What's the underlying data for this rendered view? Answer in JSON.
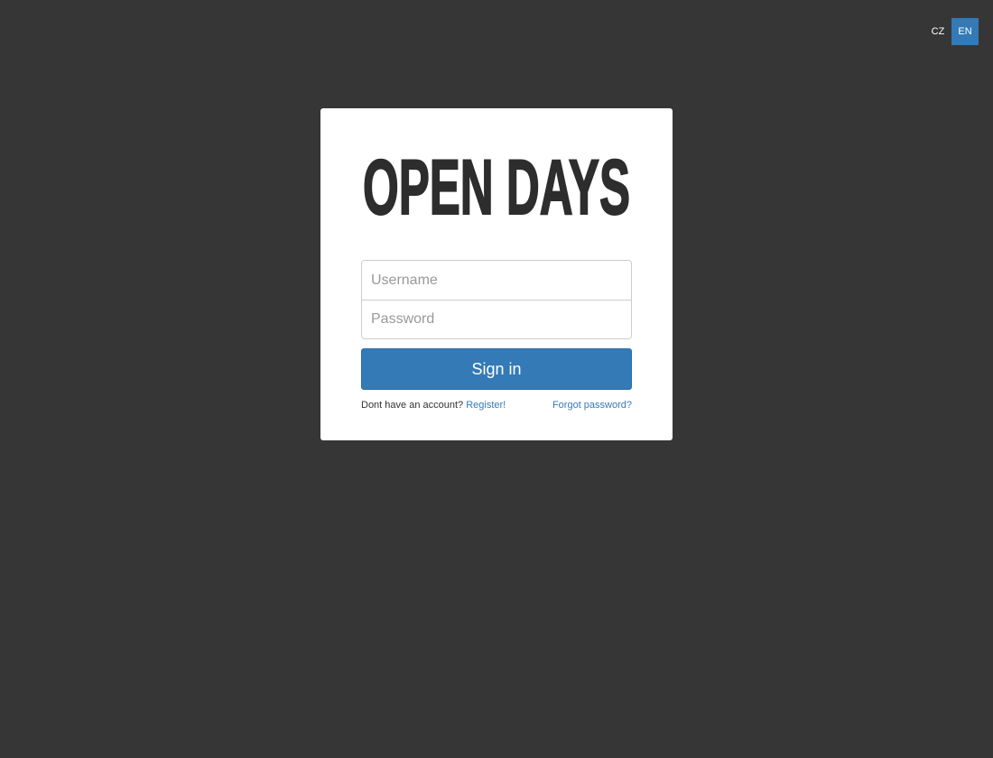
{
  "language": {
    "options": [
      {
        "label": "CZ",
        "active": false
      },
      {
        "label": "EN",
        "active": true
      }
    ]
  },
  "brand": {
    "logo_text": "OPEN DAYS"
  },
  "login": {
    "username_placeholder": "Username",
    "password_placeholder": "Password",
    "submit_label": "Sign in",
    "no_account_text": "Dont have an account?",
    "register_link": "Register!",
    "forgot_link": "Forgot password?"
  },
  "colors": {
    "background": "#363636",
    "card": "#ffffff",
    "accent": "#337ab7",
    "logo": "#2d2d2d"
  }
}
